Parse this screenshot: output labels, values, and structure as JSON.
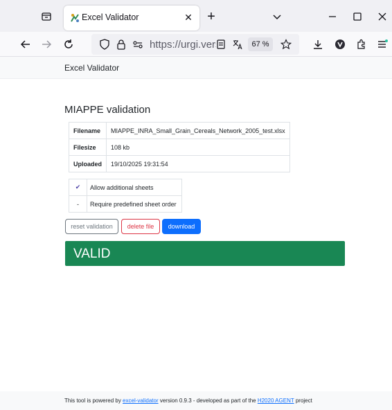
{
  "browser": {
    "tab_title": "Excel Validator",
    "tab_close": "✕",
    "new_tab": "+",
    "url": "https://urgi.versailles.inrae.fr",
    "zoom": "67 %"
  },
  "icons": {
    "tab_list": "tab-list-icon",
    "favicon": "excel-validator-favicon",
    "back": "back-arrow-icon",
    "forward": "forward-arrow-icon",
    "reload": "reload-icon",
    "tracking": "shield-icon",
    "lock": "lock-icon",
    "permissions": "permissions-icon",
    "reader": "reader-view-icon",
    "translate": "translate-icon",
    "bookmark": "star-icon",
    "downloads": "download-icon",
    "profile": "profile-icon",
    "extensions": "extensions-icon",
    "menu": "menu-icon"
  },
  "app": {
    "name": "Excel Validator"
  },
  "page": {
    "title": "MIAPPE validation",
    "file_info": [
      {
        "key": "Filename",
        "value": "MIAPPE_INRA_Small_Grain_Cereals_Network_2005_test.xlsx"
      },
      {
        "key": "Filesize",
        "value": "108 kb"
      },
      {
        "key": "Uploaded",
        "value": "19/10/2025 19:31:54"
      }
    ],
    "options": [
      {
        "mark": "✔",
        "label": "Allow additional sheets",
        "enabled": true
      },
      {
        "mark": "-",
        "label": "Require predefined sheet order",
        "enabled": false
      }
    ],
    "buttons": {
      "reset": "reset validation",
      "delete": "delete file",
      "download": "download"
    },
    "status": "VALID"
  },
  "footer": {
    "prefix": "This tool is powered by ",
    "tool_link": "excel-validator",
    "middle": " version 0.9.3 - developed as part of the ",
    "project_link": "H2020 AGENT",
    "suffix": " project"
  },
  "colors": {
    "valid": "#198754",
    "primary": "#0d6efd",
    "danger": "#dc3545",
    "secondary": "#6c757d",
    "check": "#4b3fa6"
  }
}
